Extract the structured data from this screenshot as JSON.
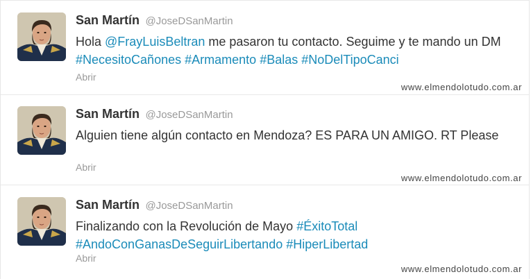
{
  "tweets": [
    {
      "name": "San Martín",
      "handle": "@JoseDSanMartin",
      "segments": [
        {
          "text": "Hola ",
          "link": false
        },
        {
          "text": "@FrayLuisBeltran",
          "link": true
        },
        {
          "text": " me pasaron tu contacto. Seguime y te mando un DM ",
          "link": false
        },
        {
          "text": "#NecesitoCañones",
          "link": true
        },
        {
          "text": " ",
          "link": false
        },
        {
          "text": "#Armamento",
          "link": true
        },
        {
          "text": " ",
          "link": false
        },
        {
          "text": "#Balas",
          "link": true
        },
        {
          "text": " ",
          "link": false
        },
        {
          "text": "#NoDelTipoCanci",
          "link": true
        }
      ],
      "open_label": "Abrir",
      "watermark": "www.elmendolotudo.com.ar"
    },
    {
      "name": "San Martín",
      "handle": "@JoseDSanMartin",
      "segments": [
        {
          "text": "Alguien tiene algún contacto en Mendoza? ES PARA UN AMIGO. RT Please",
          "link": false
        }
      ],
      "open_label": "Abrir",
      "watermark": "www.elmendolotudo.com.ar"
    },
    {
      "name": "San Martín",
      "handle": "@JoseDSanMartin",
      "segments": [
        {
          "text": "Finalizando con la Revolución de Mayo ",
          "link": false
        },
        {
          "text": "#ÉxitoTotal",
          "link": true
        },
        {
          "text": " ",
          "link": false
        },
        {
          "text": "#AndoConGanasDeSeguirLibertando",
          "link": true
        },
        {
          "text": " ",
          "link": false
        },
        {
          "text": "#HiperLibertad",
          "link": true
        }
      ],
      "open_label": "Abrir",
      "watermark": "www.elmendolotudo.com.ar"
    }
  ],
  "colors": {
    "link": "#1a8bb9",
    "name": "#333333",
    "muted": "#999999",
    "border": "#e8e8e8"
  }
}
